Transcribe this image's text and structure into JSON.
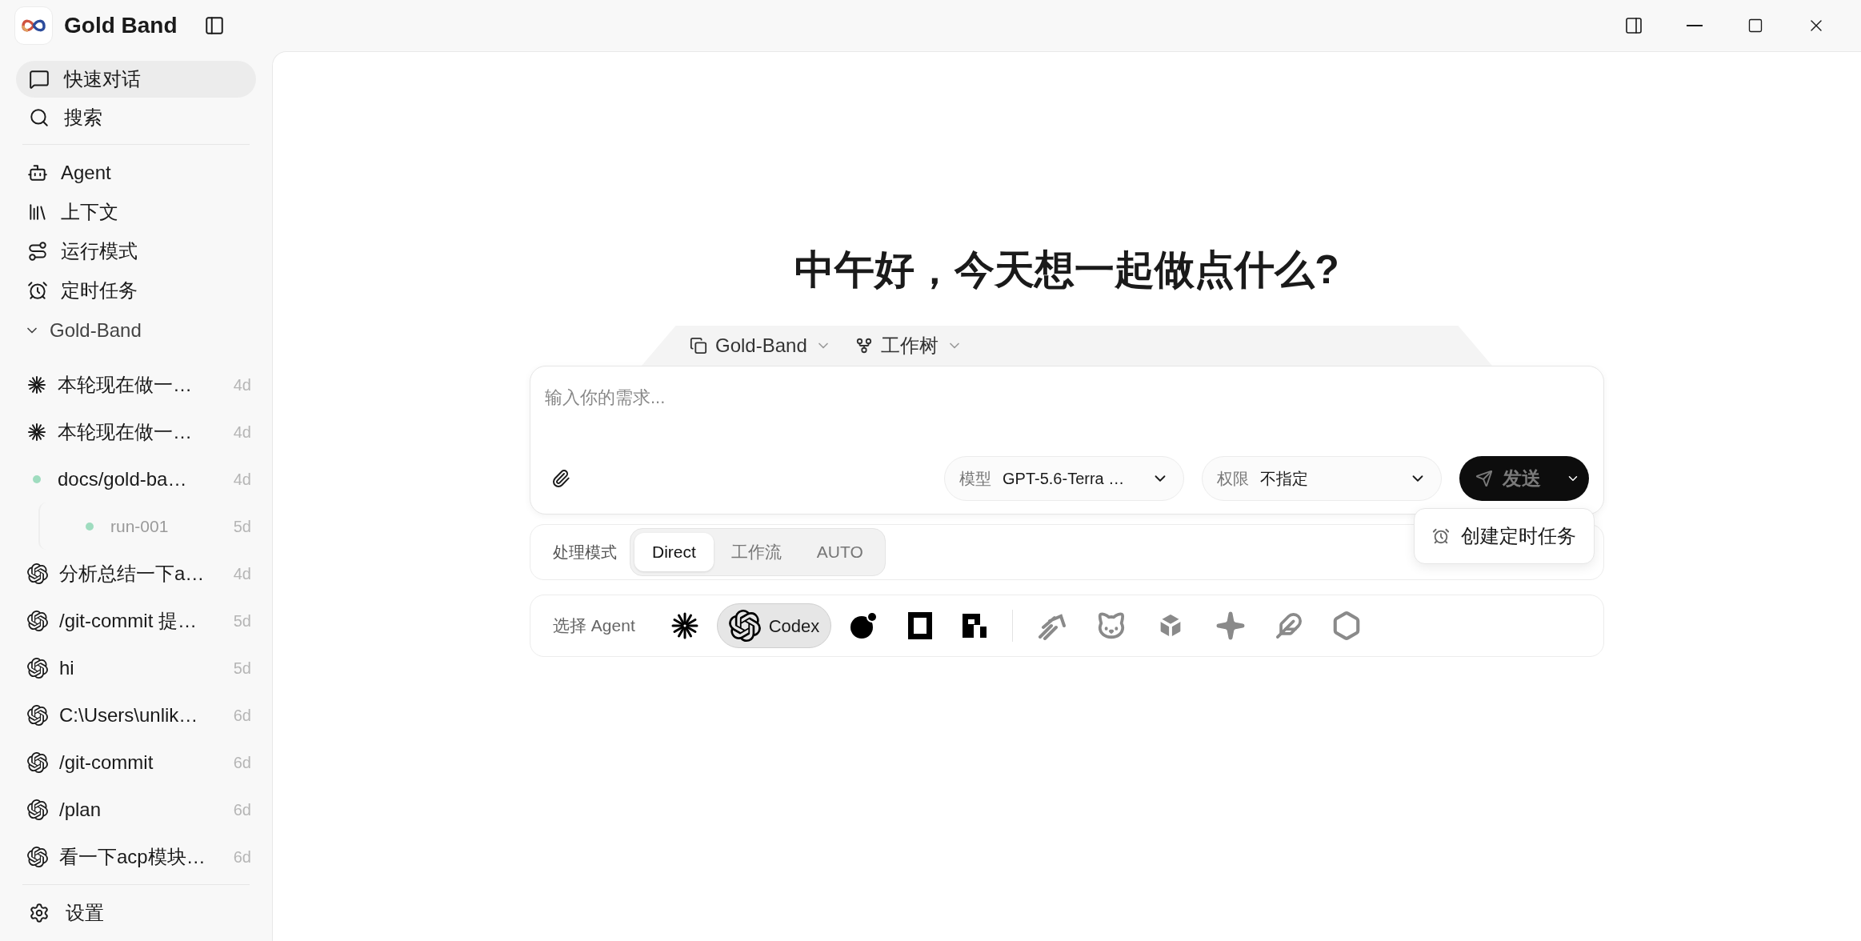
{
  "app": {
    "title": "Gold Band"
  },
  "nav": [
    {
      "kind": "chat",
      "label": "快速对话",
      "selected": true
    },
    {
      "kind": "search",
      "label": "搜索",
      "selected": false
    }
  ],
  "menu": [
    {
      "kind": "bot",
      "label": "Agent"
    },
    {
      "kind": "library",
      "label": "上下文"
    },
    {
      "kind": "route",
      "label": "运行模式"
    },
    {
      "kind": "alarm",
      "label": "定时任务"
    }
  ],
  "project": {
    "name": "Gold-Band",
    "expanded": true
  },
  "sessions": [
    {
      "kind": "spark",
      "title": "本轮现在做一…",
      "age": "4d"
    },
    {
      "kind": "spark",
      "title": "本轮现在做一…",
      "age": "4d"
    },
    {
      "kind": "dot",
      "color": "#9fdcbf",
      "title": "docs/gold-ba…",
      "age": "4d",
      "children": [
        {
          "kind": "dot",
          "color": "#9fdcbf",
          "title": "run-001",
          "age": "5d"
        }
      ]
    },
    {
      "kind": "openai",
      "title": "分析总结一下a…",
      "age": "4d"
    },
    {
      "kind": "openai",
      "title": "/git-commit 提…",
      "age": "5d"
    },
    {
      "kind": "openai",
      "title": "hi",
      "age": "5d"
    },
    {
      "kind": "openai",
      "title": "C:\\Users\\unlik…",
      "age": "6d"
    },
    {
      "kind": "openai",
      "title": "/git-commit",
      "age": "6d"
    },
    {
      "kind": "openai",
      "title": "/plan",
      "age": "6d"
    },
    {
      "kind": "openai",
      "title": "看一下acp模块…",
      "age": "6d"
    }
  ],
  "settings": {
    "label": "设置"
  },
  "greeting": "中午好，今天想一起做点什么?",
  "context_bar": {
    "workspace": "Gold-Band",
    "worktree": "工作树"
  },
  "composer": {
    "placeholder": "输入你的需求...",
    "model": {
      "label": "模型",
      "value": "GPT-5.6-Terra …"
    },
    "permission": {
      "label": "权限",
      "value": "不指定"
    },
    "send": {
      "label": "发送",
      "disabled": true
    },
    "send_menu": [
      {
        "label": "创建定时任务"
      }
    ]
  },
  "mode": {
    "label": "处理模式",
    "tabs": [
      {
        "label": "Direct",
        "selected": true
      },
      {
        "label": "工作流",
        "selected": false
      },
      {
        "label": "AUTO",
        "selected": false
      }
    ]
  },
  "agent_picker": {
    "label": "选择 Agent",
    "groups": [
      {
        "agents": [
          {
            "kind": "spark",
            "selected": false,
            "disabled": false
          },
          {
            "kind": "openai",
            "label": "Codex",
            "selected": true,
            "disabled": false
          },
          {
            "kind": "moon",
            "selected": false,
            "disabled": false
          },
          {
            "kind": "frame",
            "selected": false,
            "disabled": false
          },
          {
            "kind": "blocks",
            "selected": false,
            "disabled": false
          }
        ]
      },
      {
        "agents": [
          {
            "kind": "stripes",
            "selected": false,
            "disabled": true
          },
          {
            "kind": "cat",
            "selected": false,
            "disabled": true
          },
          {
            "kind": "cube",
            "selected": false,
            "disabled": true
          },
          {
            "kind": "star",
            "selected": false,
            "disabled": true
          },
          {
            "kind": "feather",
            "selected": false,
            "disabled": true
          },
          {
            "kind": "hexagon",
            "selected": false,
            "disabled": true
          }
        ]
      }
    ]
  }
}
